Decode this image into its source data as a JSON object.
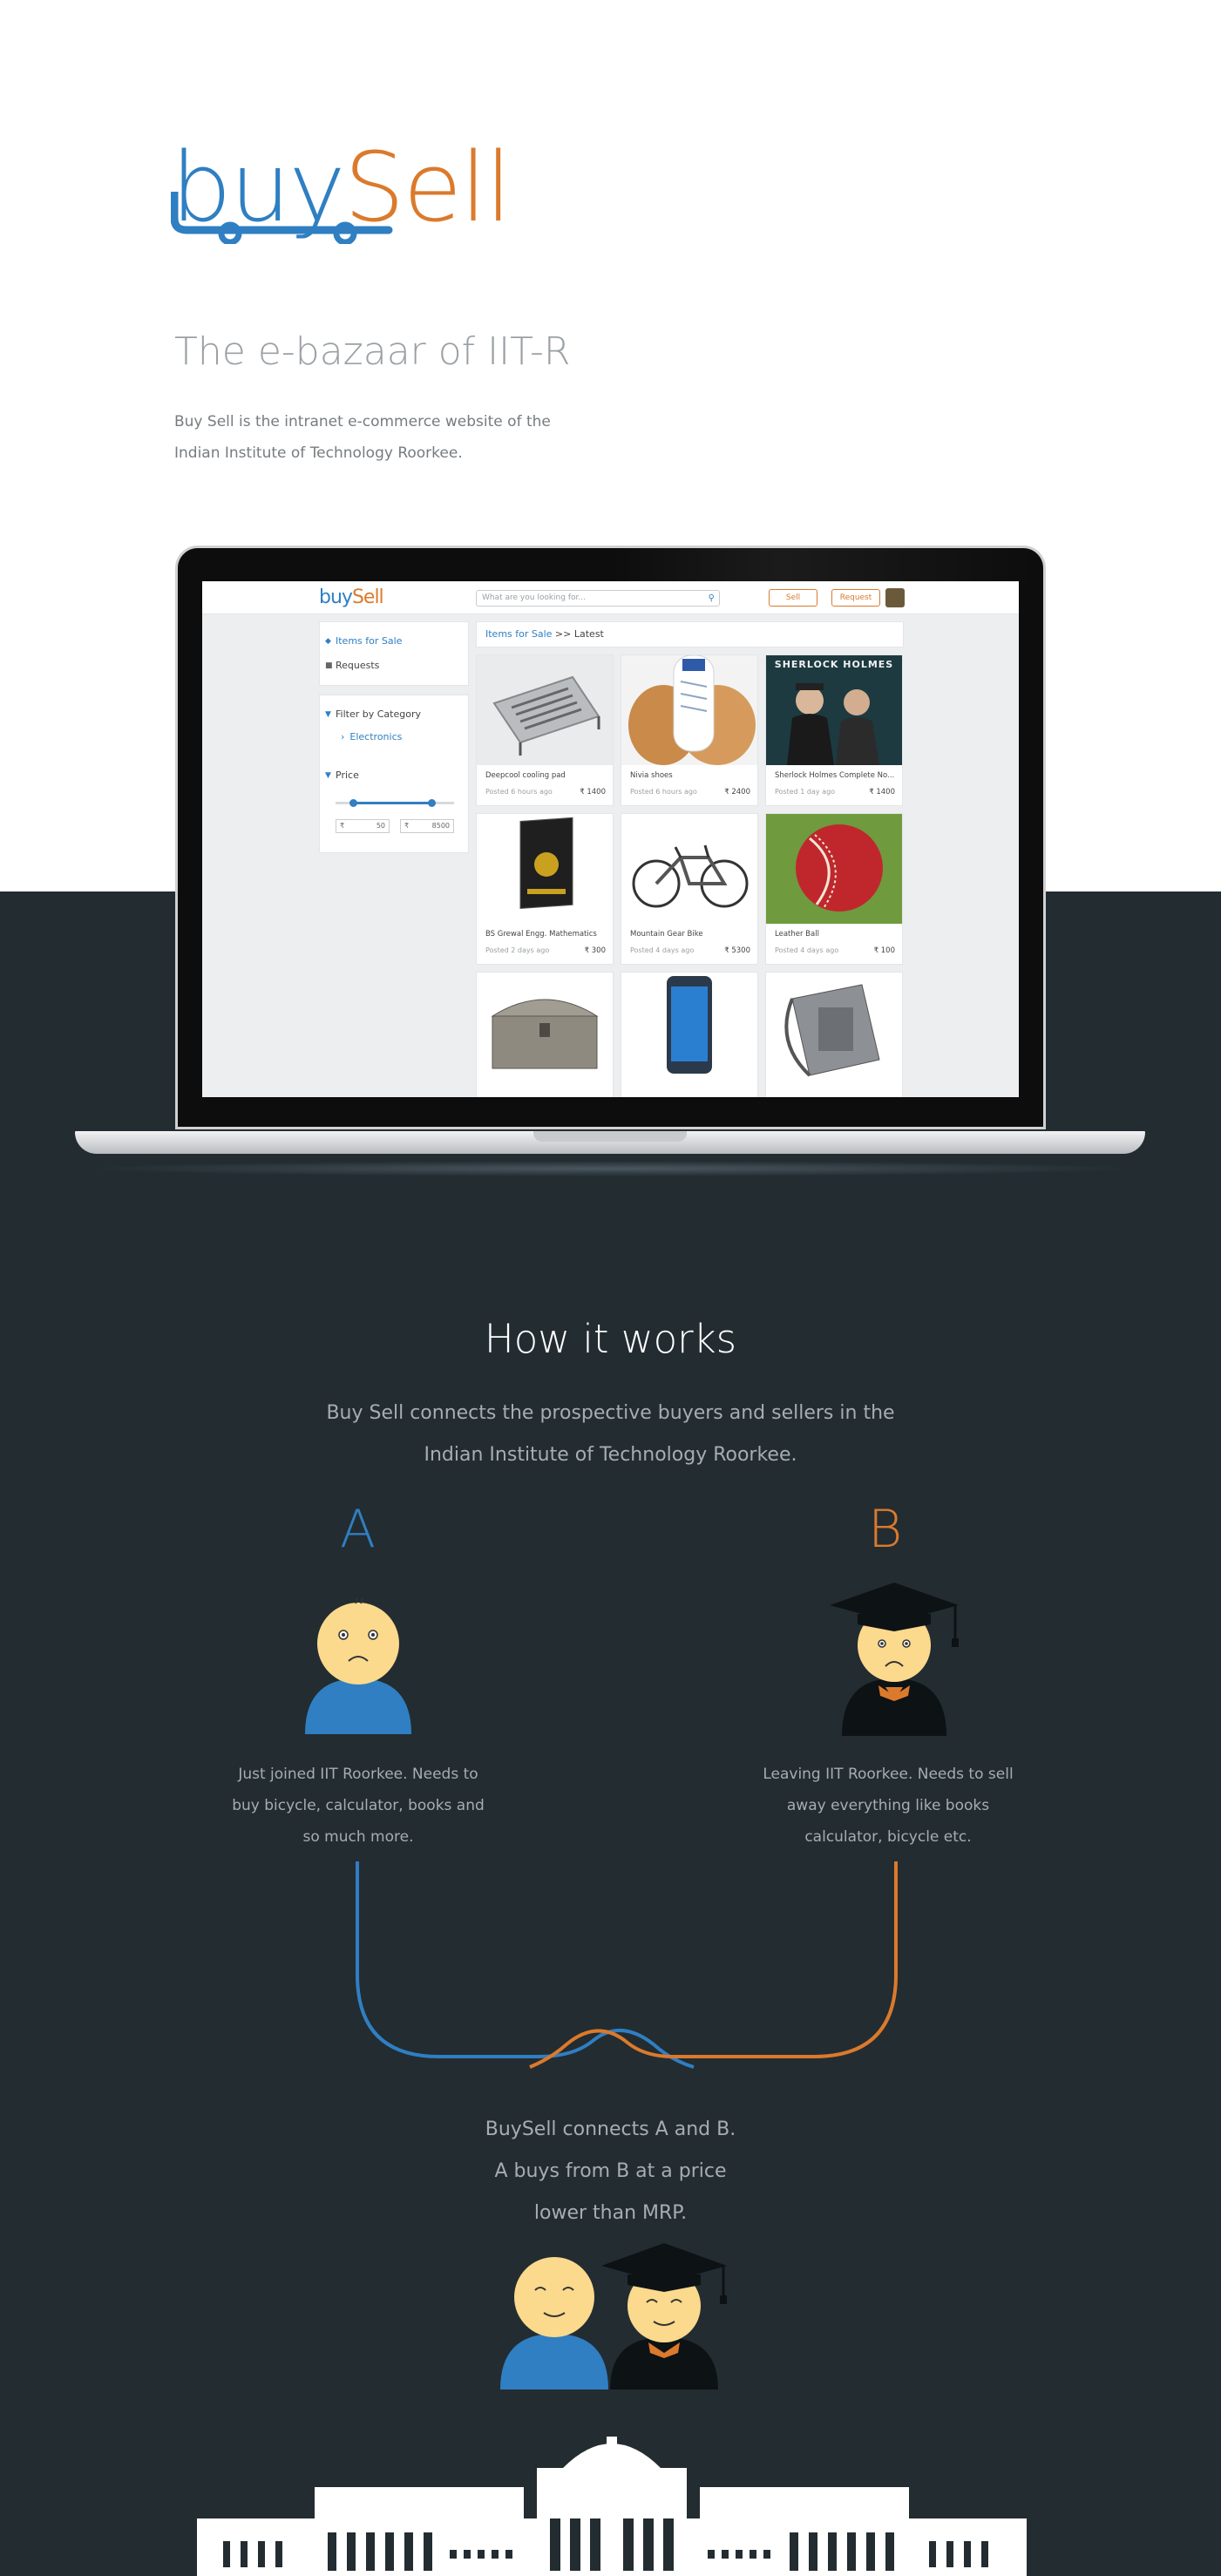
{
  "brand": {
    "logo_buy": "buy",
    "logo_sell": "Sell",
    "color_blue": "#2f7fc2",
    "color_orange": "#db7a2c",
    "color_dark": "#232c31"
  },
  "hero": {
    "tagline": "The e-bazaar of IIT-R",
    "intro_line1": "Buy Sell is the intranet e-commerce website of the",
    "intro_line2": "Indian Institute of Technology Roorkee."
  },
  "mock_site": {
    "logo_buy": "buy",
    "logo_sell": "Sell",
    "search_placeholder": "What are you looking for...",
    "sell_button": "Sell",
    "request_button": "Request",
    "sidebar": {
      "items_for_sale": "Items for Sale",
      "requests": "Requests",
      "filter_by_category": "Filter by Category",
      "category_electronics": "Electronics",
      "price_label": "Price",
      "price_currency": "₹",
      "price_min": "50",
      "price_max": "8500"
    },
    "breadcrumb": {
      "link": "Items for Sale",
      "rest": " >> Latest"
    },
    "products": [
      {
        "title": "Deepcool cooling pad",
        "posted": "Posted 6 hours ago",
        "price": "₹ 1400",
        "image": "cooling-pad-image"
      },
      {
        "title": "Nivia shoes",
        "posted": "Posted 6 hours ago",
        "price": "₹ 2400",
        "image": "shoes-image"
      },
      {
        "title": "Sherlock Holmes Complete No...",
        "posted": "Posted 1 day ago",
        "price": "₹ 1400",
        "image": "sherlock-poster-image"
      },
      {
        "title": "BS Grewal Engg. Mathematics",
        "posted": "Posted 2 days ago",
        "price": "₹ 300",
        "image": "book-image"
      },
      {
        "title": "Mountain Gear Bike",
        "posted": "Posted 4 days ago",
        "price": "₹ 5300",
        "image": "bicycle-image"
      },
      {
        "title": "Leather Ball",
        "posted": "Posted 4 days ago",
        "price": "₹ 100",
        "image": "cricket-ball-image"
      },
      {
        "title": "",
        "posted": "",
        "price": "",
        "image": "chest-image"
      },
      {
        "title": "",
        "posted": "",
        "price": "",
        "image": "phone-image"
      },
      {
        "title": "",
        "posted": "",
        "price": "",
        "image": "bag-image"
      }
    ],
    "poster_text": "SHERLOCK HOLMES"
  },
  "how_it_works": {
    "title": "How it works",
    "subtitle_line1": "Buy Sell connects the prospective buyers and sellers in the",
    "subtitle_line2": "Indian Institute of Technology Roorkee.",
    "person_a": {
      "letter": "A",
      "desc_line1": "Just joined IIT Roorkee. Needs to",
      "desc_line2": "buy bicycle, calculator, books and",
      "desc_line3": "so much more."
    },
    "person_b": {
      "letter": "B",
      "desc_line1": "Leaving IIT Roorkee. Needs to sell",
      "desc_line2": "away everything like books",
      "desc_line3": "calculator, bicycle etc."
    },
    "connect_line1": "BuySell connects A and B.",
    "connect_line2": "A buys from B at a price",
    "connect_line3": "lower than MRP."
  }
}
